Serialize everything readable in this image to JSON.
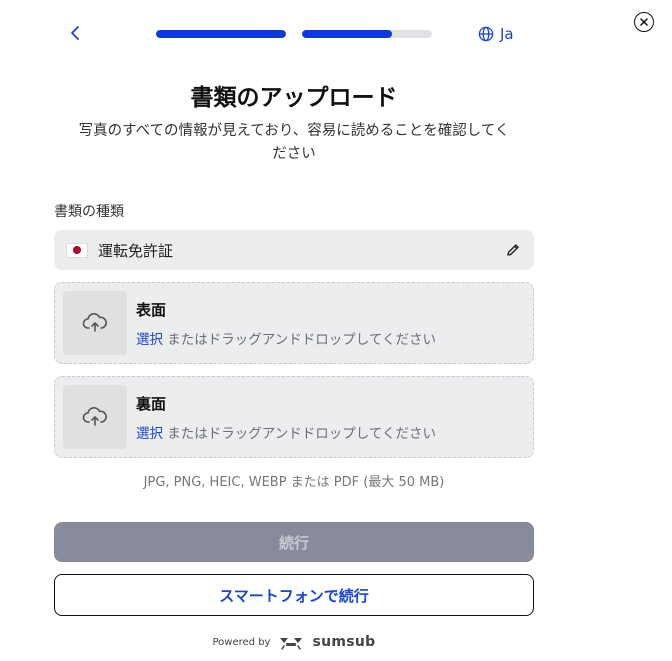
{
  "header": {
    "back_icon": "chevron-left-icon",
    "close_icon": "close-circle-icon",
    "language_label": "Ja",
    "language_icon": "globe-icon",
    "progress": [
      1.0,
      0.69
    ]
  },
  "title": "書類のアップロード",
  "subtitle_line1": "写真のすべての情報が見えており、容易に読めることを確認してく",
  "subtitle_line2": "ださい",
  "doc_type": {
    "label": "書類の種類",
    "value": "運転免許証",
    "flag_icon": "japan-flag-icon",
    "edit_icon": "pencil-icon"
  },
  "uploads": [
    {
      "side": "表面",
      "select_link": "選択",
      "hint": " またはドラッグアンドドロップしてください",
      "icon": "cloud-upload-icon"
    },
    {
      "side": "裏面",
      "select_link": "選択",
      "hint": " またはドラッグアンドドロップしてください",
      "icon": "cloud-upload-icon"
    }
  ],
  "formats_note": "JPG, PNG, HEIC, WEBP または PDF (最大 50 MB)",
  "continue_label": "続行",
  "phone_continue_label": "スマートフォンで続行",
  "footer": {
    "powered_by": "Powered by",
    "brand": "sumsub",
    "brand_icon": "sumsub-logo-icon"
  },
  "colors": {
    "accent": "#1845d6",
    "progress_fill": "#0a3bd8",
    "disabled_button": "#888b9c",
    "field_bg": "#ecedee"
  }
}
